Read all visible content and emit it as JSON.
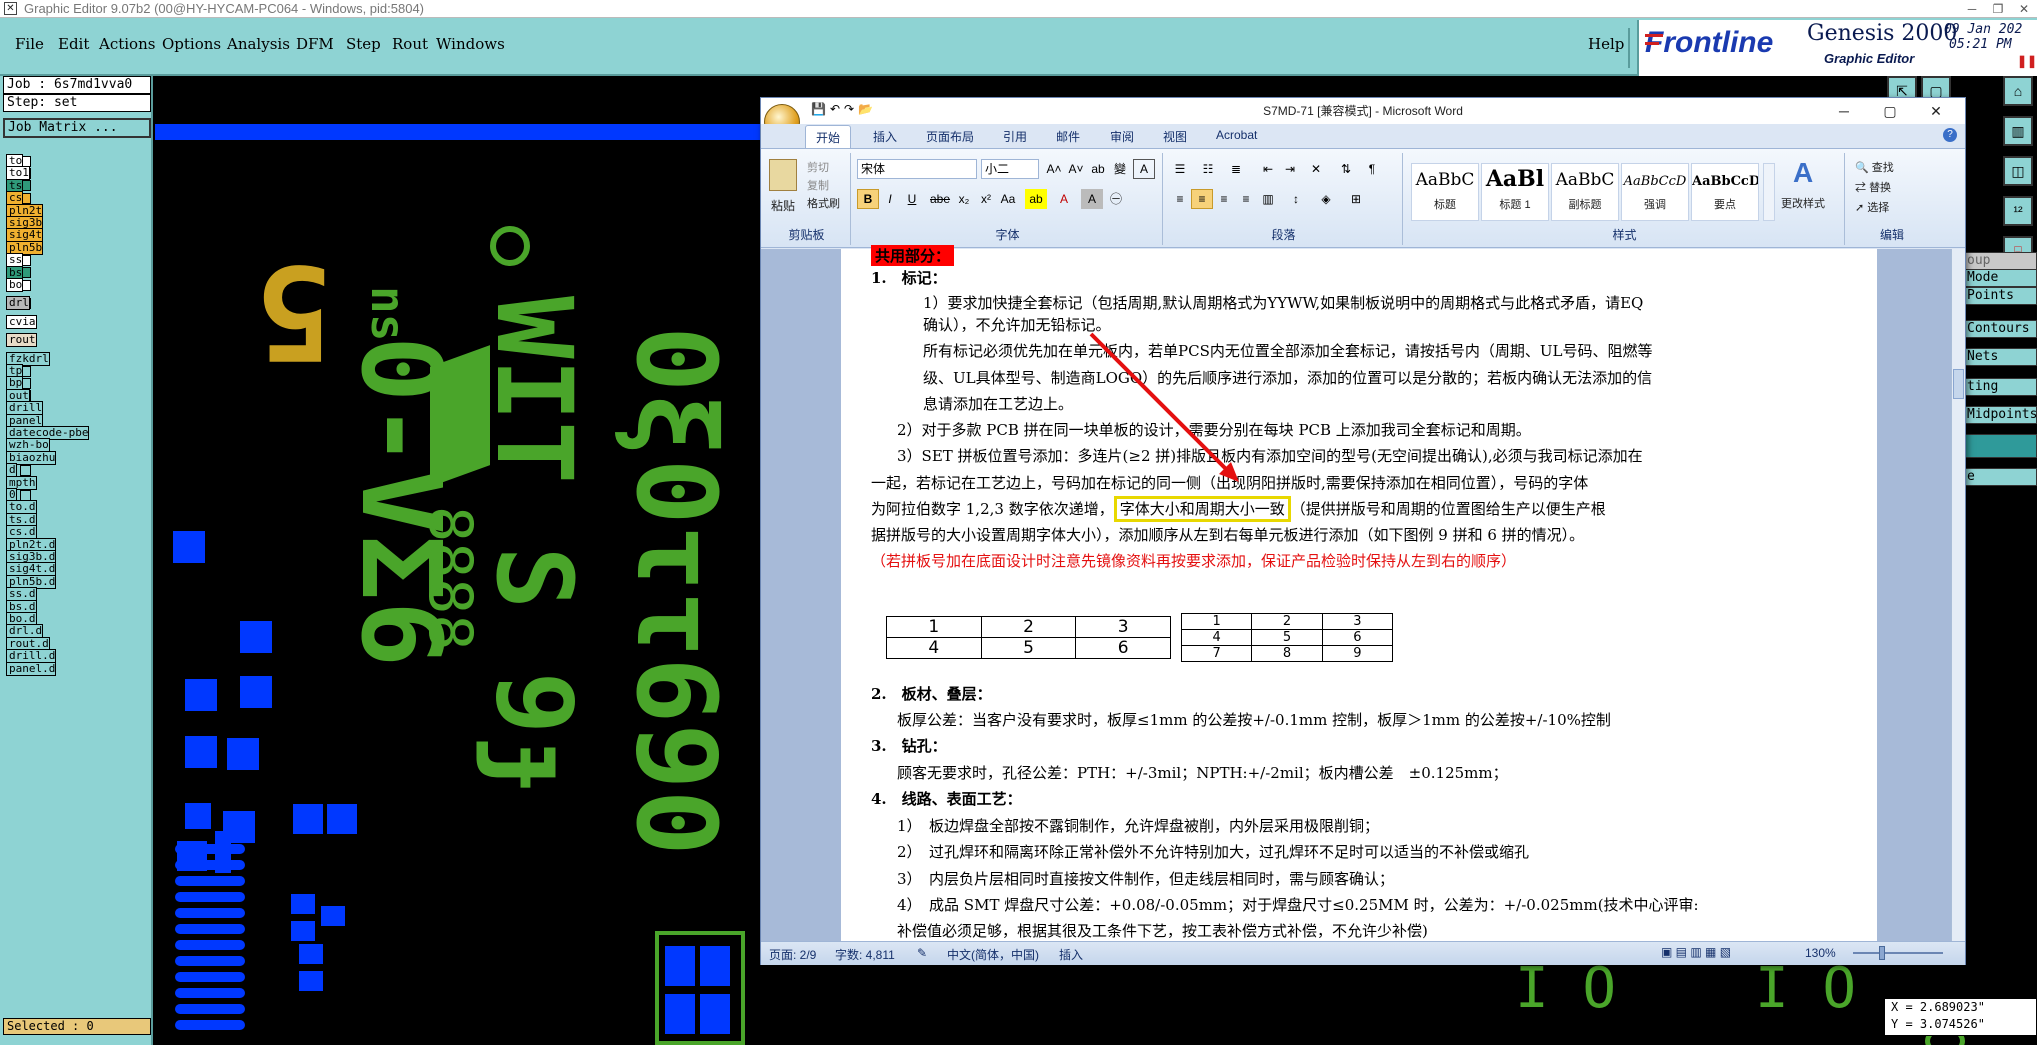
{
  "window": {
    "title": "Graphic Editor 9.07b2 (00@HY-HYCAM-PC064 - Windows, pid:5804)"
  },
  "menu": {
    "items": [
      {
        "label": "File"
      },
      {
        "label": "Edit"
      },
      {
        "label": "Actions"
      },
      {
        "label": "Options"
      },
      {
        "label": "Analysis"
      },
      {
        "label": "DFM"
      },
      {
        "label": "Step"
      },
      {
        "label": "Rout"
      },
      {
        "label": "Windows"
      }
    ],
    "help": "Help"
  },
  "brand": {
    "logo": "Frontline",
    "product": "Genesis 2000",
    "subtitle": "Graphic Editor",
    "date": "09 Jan 202",
    "time": "05:21 PM"
  },
  "job": {
    "name": "Job : 6s7md1vva0",
    "step": "Step: set",
    "matrix": "Job Matrix ..."
  },
  "layers": [
    {
      "name": "to",
      "color": "#ffffff"
    },
    {
      "name": "to1",
      "color": "#ffffff"
    },
    {
      "name": "ts",
      "color": "#2f9a7a"
    },
    {
      "name": "cs",
      "color": "#f0b030"
    },
    {
      "name": "pln2t",
      "color": "#f0b030"
    },
    {
      "name": "sig3b",
      "color": "#f0b030"
    },
    {
      "name": "sig4t",
      "color": "#f0b030"
    },
    {
      "name": "pln5b",
      "color": "#f0b030"
    },
    {
      "name": "ss",
      "color": "#ffffff"
    },
    {
      "name": "bs",
      "color": "#2f9a7a"
    },
    {
      "name": "bo",
      "color": "#ffffff"
    },
    {
      "name": "drl",
      "color": "#b8b8b8"
    },
    {
      "name": "cvia",
      "color": "#ffffff"
    },
    {
      "name": "rout",
      "color": "#e8dcc8"
    },
    {
      "name": "fzkdrl",
      "color": "#8ed3d3"
    },
    {
      "name": "tp",
      "color": "#8ed3d3"
    },
    {
      "name": "bp",
      "color": "#8ed3d3"
    },
    {
      "name": "out",
      "color": "#8ed3d3"
    },
    {
      "name": "drill",
      "color": "#8ed3d3"
    },
    {
      "name": "panel",
      "color": "#8ed3d3"
    },
    {
      "name": "datecode-pbe",
      "color": "#8ed3d3"
    },
    {
      "name": "wzh-bo",
      "color": "#8ed3d3"
    },
    {
      "name": "biaozhu",
      "color": "#8ed3d3"
    },
    {
      "name": "d",
      "color": "#8ed3d3"
    },
    {
      "name": "mpth",
      "color": "#8ed3d3"
    },
    {
      "name": "0",
      "color": "#8ed3d3"
    },
    {
      "name": "to.d",
      "color": "#8ed3d3"
    },
    {
      "name": "ts.d",
      "color": "#8ed3d3"
    },
    {
      "name": "cs.d",
      "color": "#8ed3d3"
    },
    {
      "name": "pln2t.d",
      "color": "#8ed3d3"
    },
    {
      "name": "sig3b.d",
      "color": "#8ed3d3"
    },
    {
      "name": "sig4t.d",
      "color": "#8ed3d3"
    },
    {
      "name": "pln5b.d",
      "color": "#8ed3d3"
    },
    {
      "name": "ss.d",
      "color": "#8ed3d3"
    },
    {
      "name": "bs.d",
      "color": "#8ed3d3"
    },
    {
      "name": "bo.d",
      "color": "#8ed3d3"
    },
    {
      "name": "drl.d",
      "color": "#8ed3d3"
    },
    {
      "name": "rout.d",
      "color": "#8ed3d3"
    },
    {
      "name": "drill.d",
      "color": "#8ed3d3"
    },
    {
      "name": "panel.d",
      "color": "#8ed3d3"
    }
  ],
  "selected": "Selected : 0",
  "coords": {
    "x": "X = 2.689023\"",
    "y": "Y = 3.074526\""
  },
  "right_modes": [
    "Mode",
    "Points",
    "Contours",
    "Nets",
    "ting",
    "Midpoints",
    "e",
    "oup"
  ],
  "canvas_text": {
    "t1": "0-VΣ6",
    "t2": "0ξ0ττ690",
    "t3": "WIT S 9ɟ",
    "t4": "8888",
    "t5": "ns",
    "t6": "5"
  },
  "word": {
    "title": "S7MD-71 [兼容模式] - Microsoft Word",
    "tabs": [
      "开始",
      "插入",
      "页面布局",
      "引用",
      "邮件",
      "审阅",
      "视图",
      "Acrobat"
    ],
    "ribbon": {
      "clipboard": {
        "label": "剪贴板",
        "paste": "粘贴",
        "cut": "剪切",
        "copy": "复制",
        "format": "格式刷"
      },
      "font": {
        "label": "字体",
        "name": "宋体",
        "size": "小二"
      },
      "paragraph": {
        "label": "段落"
      },
      "styles": {
        "label": "样式",
        "items": [
          {
            "preview": "AaBbC",
            "name": "标题"
          },
          {
            "preview": "AaBl",
            "name": "标题 1"
          },
          {
            "preview": "AaBbC",
            "name": "副标题"
          },
          {
            "preview": "AaBbCcD",
            "name": "强调"
          },
          {
            "preview": "AaBbCcD",
            "name": "要点"
          }
        ],
        "change": "更改样式"
      },
      "edit": {
        "label": "编辑",
        "find": "查找",
        "replace": "替换",
        "select": "选择"
      }
    },
    "doc": {
      "heading": "共用部分：",
      "s1": "1.　标记：",
      "p1a": "1）要求加快捷全套标记（包括周期,默认周期格式为YYWW,如果制板说明中的周期格式与此格式矛盾，请EQ",
      "p1b": "确认），不允许加无铅标记。",
      "p2a": "所有标记必须优先加在单元板内，若单PCS内无位置全部添加全套标记，请按括号内（周期、UL号码、阻燃等",
      "p2b": "级、UL具体型号、制造商LOGO）的先后顺序进行添加，添加的位置可以是分散的；若板内确认无法添加的信",
      "p2c": "息请添加在工艺边上。",
      "p3": "2）对于多款 PCB 拼在同一块单板的设计，需要分别在每块 PCB 上添加我司全套标记和周期。",
      "p4a": "3）SET 拼板位置号添加：多连片(≥2 拼)排版且板内有添加空间的型号(无空间提出确认),必须与我司标记添加在",
      "p4b": "一起，若标记在工艺边上，号码加在标记的同一侧（出现阴阳拼版时,需要保持添加在相同位置），号码的字体",
      "p4c_pre": "为阿拉伯数字 1,2,3 数字依次递增，",
      "p4c_box": "字体大小和周期大小一致",
      "p4c_post": "（提供拼版号和周期的位置图给生产以便生产根",
      "p4d": "据拼版号的大小设置周期字体大小），添加顺序从左到右每单元板进行添加（如下图例 9 拼和 6 拼的情况）。",
      "p4e": "（若拼板号加在底面设计时注意先镜像资料再按要求添加，保证产品检验时保持从左到右的顺序）",
      "table6": [
        [
          "1",
          "2",
          "3"
        ],
        [
          "4",
          "5",
          "6"
        ]
      ],
      "table9": [
        [
          "1",
          "2",
          "3"
        ],
        [
          "4",
          "5",
          "6"
        ],
        [
          "7",
          "8",
          "9"
        ]
      ],
      "s2": "2.　板材、叠层：",
      "p5": "板厚公差：当客户没有要求时，板厚≤1mm 的公差按+/-0.1mm 控制，板厚＞1mm 的公差按+/-10%控制",
      "s3": "3.　钻孔：",
      "p6": "顾客无要求时，孔径公差：PTH：+/-3mil；NPTH:+/-2mil；板内槽公差　±0.125mm；",
      "s4": "4.　线路、表面工艺：",
      "p7": "1）　板边焊盘全部按不露铜制作，允许焊盘被削，内外层采用极限削铜；",
      "p8": "2）　过孔焊环和隔离环除正常补偿外不允许特别加大，过孔焊环不足时可以适当的不补偿或缩孔",
      "p9": "3）　内层负片层相同时直接按文件制作，但走线层相同时，需与顾客确认；",
      "p10": "4）　成品 SMT 焊盘尺寸公差：+0.08/-0.05mm；对于焊盘尺寸≤0.25MM 时，公差为：+/-0.025mm(技术中心评审:",
      "p11": "补偿值必须足够，根据其很及工条件下艺，按工表补偿方式补偿，不允许少补偿)"
    },
    "status": {
      "page": "页面: 2/9",
      "words": "字数: 4,811",
      "lang": "中文(简体，中国)",
      "mode": "插入",
      "zoom": "130%"
    }
  }
}
